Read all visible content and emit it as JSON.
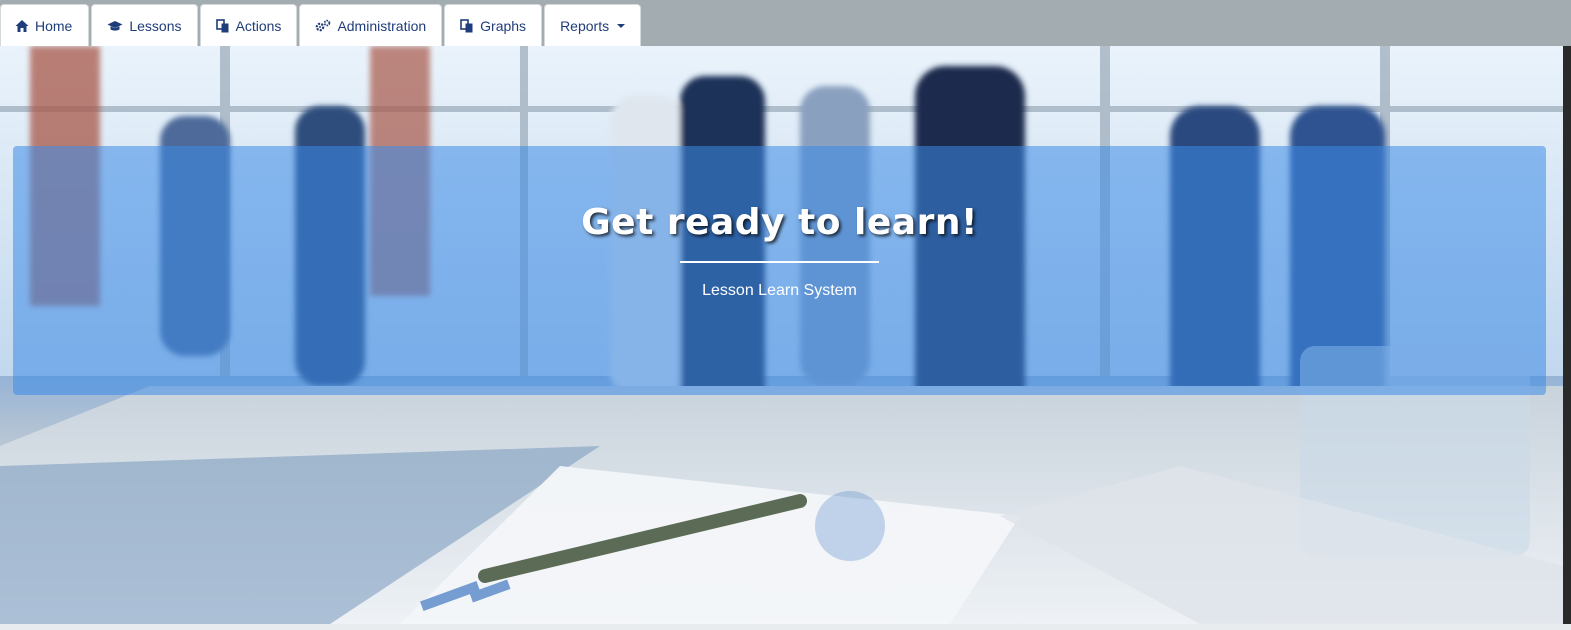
{
  "nav": {
    "tabs": [
      {
        "label": "Home",
        "icon": "home-icon"
      },
      {
        "label": "Lessons",
        "icon": "graduation-cap-icon"
      },
      {
        "label": "Actions",
        "icon": "copy-icon"
      },
      {
        "label": "Administration",
        "icon": "cogs-icon"
      },
      {
        "label": "Graphs",
        "icon": "copy-icon"
      },
      {
        "label": "Reports",
        "icon": "caret-down-icon"
      }
    ]
  },
  "hero": {
    "title": "Get ready to learn!",
    "subtitle": "Lesson Learn System"
  },
  "colors": {
    "nav_text": "#1f3d7a",
    "nav_bar": "#a3acb0",
    "caption_overlay": "#3d8ae6"
  }
}
